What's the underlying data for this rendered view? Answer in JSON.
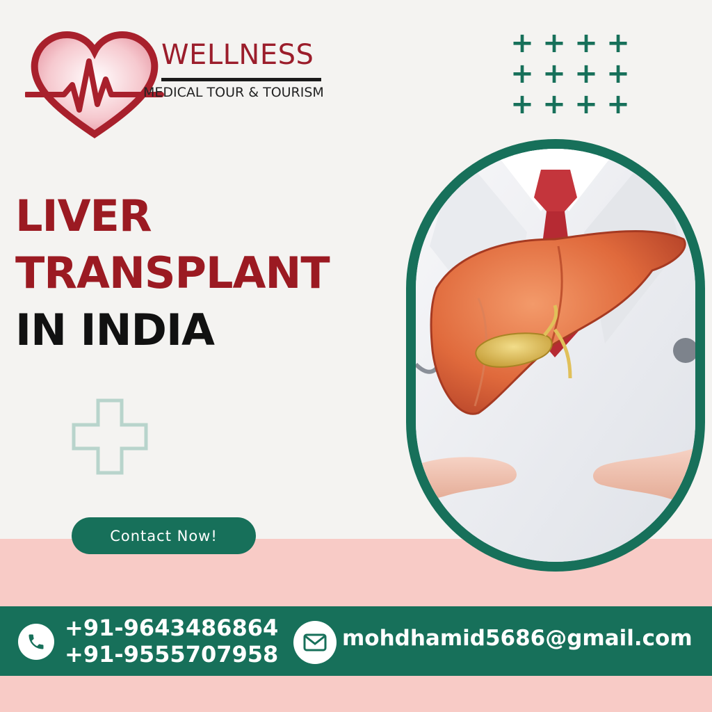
{
  "brand": {
    "name": "WELLNESS",
    "tagline": "MEDICAL TOUR & TOURISM"
  },
  "headline": {
    "line1": "LIVER",
    "line2": "TRANSPLANT",
    "line3": "IN INDIA"
  },
  "cta": {
    "label": "Contact Now!"
  },
  "contact": {
    "phone1": "+91-9643486864",
    "phone2": "+91-9555707958",
    "email": "mohdhamid5686@gmail.com"
  },
  "icons": {
    "phone": "phone-icon",
    "mail": "mail-icon",
    "logo": "heart-pulse-icon",
    "plus": "plus-icon",
    "cross": "medical-cross-icon"
  },
  "colors": {
    "brand_red": "#9b1a22",
    "brand_green": "#17705a",
    "pink": "#f8cbc6",
    "background": "#f4f3f1"
  }
}
